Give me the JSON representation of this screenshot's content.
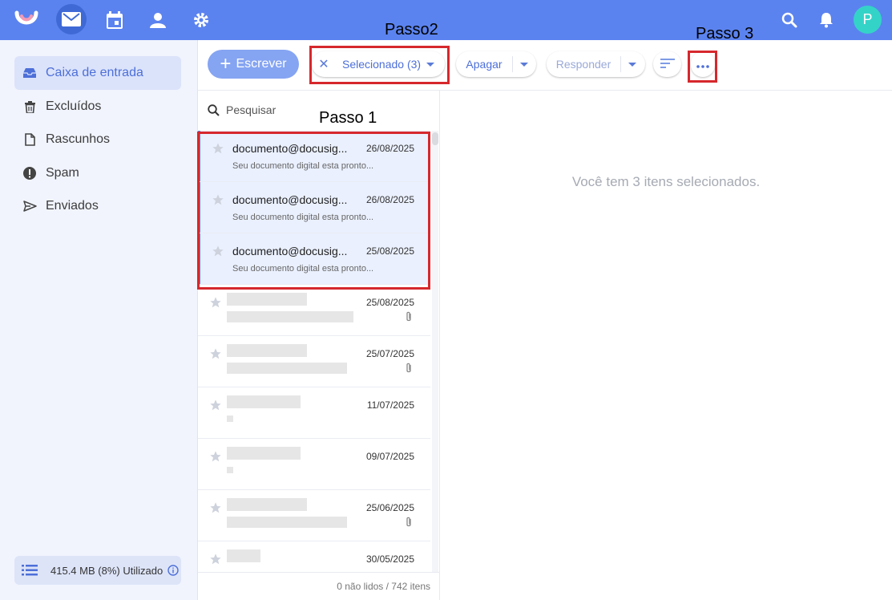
{
  "colors": {
    "topbar": "#5b83ef",
    "accent": "#4d6fd8",
    "annotation_red": "#d6282d",
    "avatar": "#34d3c8"
  },
  "topbar": {
    "icons": [
      "logo-icon",
      "mail-icon",
      "calendar-icon",
      "contacts-icon",
      "settings-icon",
      "search-icon",
      "bell-icon"
    ],
    "avatar_letter": "P"
  },
  "sidebar": {
    "items": [
      {
        "label": "Caixa de entrada",
        "icon": "inbox-icon",
        "active": true
      },
      {
        "label": "Excluídos",
        "icon": "trash-icon"
      },
      {
        "label": "Rascunhos",
        "icon": "draft-icon"
      },
      {
        "label": "Spam",
        "icon": "spam-icon"
      },
      {
        "label": "Enviados",
        "icon": "send-icon"
      }
    ],
    "storage": "415.4 MB (8%) Utilizado"
  },
  "toolbar": {
    "compose": "Escrever",
    "selected": "Selecionado (3)",
    "delete": "Apagar",
    "reply": "Responder"
  },
  "annotations": {
    "step1": "Passo 1",
    "step2": "Passo2",
    "step3": "Passo 3"
  },
  "list": {
    "search_placeholder": "Pesquisar",
    "rows": [
      {
        "sender": "documento@docusig...",
        "date": "26/08/2025",
        "preview": "Seu documento digital esta pronto..."
      },
      {
        "sender": "documento@docusig...",
        "date": "26/08/2025",
        "preview": "Seu documento digital esta pronto..."
      },
      {
        "sender": "documento@docusig...",
        "date": "25/08/2025",
        "preview": "Seu documento digital esta pronto..."
      },
      {
        "date": "25/08/2025",
        "attachment": true
      },
      {
        "date": "25/07/2025",
        "attachment": true
      },
      {
        "date": "11/07/2025"
      },
      {
        "date": "09/07/2025"
      },
      {
        "date": "25/06/2025",
        "attachment": true
      },
      {
        "date": "30/05/2025"
      }
    ],
    "footer": "0 não lidos / 742 itens"
  },
  "reading": {
    "message": "Você tem 3 itens selecionados."
  }
}
